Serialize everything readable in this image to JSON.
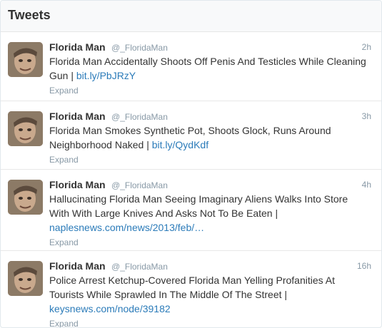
{
  "header": {
    "title": "Tweets"
  },
  "tweets": [
    {
      "name": "Florida Man",
      "handle": "@_FloridaMan",
      "time": "2h",
      "text": "Florida Man Accidentally Shoots Off Penis And Testicles While Cleaning Gun | ",
      "link": "bit.ly/PbJRzY",
      "expand": "Expand"
    },
    {
      "name": "Florida Man",
      "handle": "@_FloridaMan",
      "time": "3h",
      "text": "Florida Man Smokes Synthetic Pot, Shoots Glock, Runs Around Neighborhood Naked | ",
      "link": "bit.ly/QydKdf",
      "expand": "Expand"
    },
    {
      "name": "Florida Man",
      "handle": "@_FloridaMan",
      "time": "4h",
      "text": "Hallucinating Florida Man Seeing Imaginary Aliens Walks Into Store With With Large Knives And Asks Not To Be Eaten | ",
      "link": "naplesnews.com/news/2013/feb/…",
      "expand": "Expand"
    },
    {
      "name": "Florida Man",
      "handle": "@_FloridaMan",
      "time": "16h",
      "text": "Police Arrest Ketchup-Covered Florida Man Yelling Profanities At Tourists While Sprawled In The Middle Of The Street | ",
      "link": "keysnews.com/node/39182",
      "expand": "Expand"
    }
  ],
  "colors": {
    "link": "#2b7bb9",
    "muted": "#8899a6",
    "text": "#333333"
  },
  "icons": {
    "avatar": "profile-photo"
  }
}
